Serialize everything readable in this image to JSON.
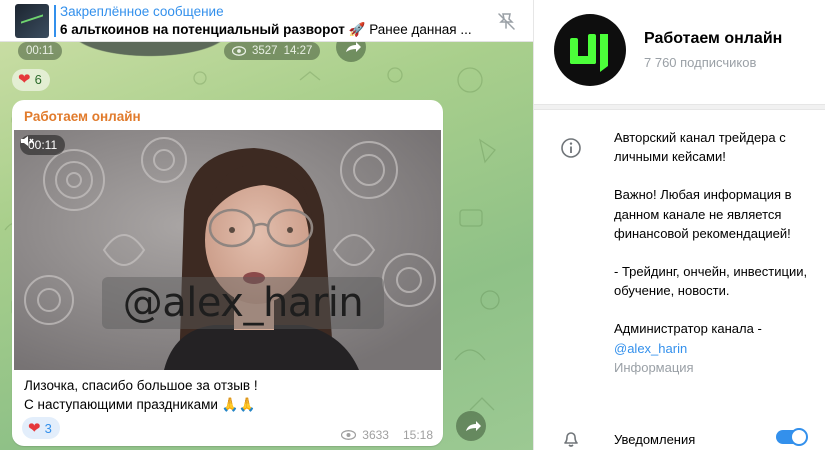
{
  "pinned": {
    "title": "Закреплённое сообщение",
    "text_bold": "6 альткоинов на потенциальный разворот 🚀",
    "text_rest": "Ранее данная ..."
  },
  "previous_message": {
    "duration": "00:11",
    "views": "3527",
    "time": "14:27",
    "reaction_count": "6"
  },
  "message": {
    "author": "Работаем онлайн",
    "video_duration": "00:11",
    "video_watermark": "@alex_harin",
    "caption_line1": "Лизочка, спасибо большое за отзыв !",
    "caption_line2": "С наступающими праздниками 🙏🙏",
    "reaction_count": "3",
    "views": "3633",
    "time": "15:18"
  },
  "channel": {
    "name": "Работаем онлайн",
    "subscribers": "7 760 подписчиков",
    "desc_p1": "Авторский канал трейдера с личными кейсами!",
    "desc_p2": "Важно! Любая информация в данном канале не является финансовой рекомендацией!",
    "desc_p3": "- Трейдинг, ончейн, инвестиции, обучение, новости.",
    "desc_p4": "Администратор канала -",
    "admin_link": "@alex_harin",
    "info_label": "Информация",
    "notifications_label": "Уведомления",
    "notifications_on": true
  },
  "colors": {
    "accent": "#3390ec",
    "author": "#e17b2c",
    "heart": "#e5383b",
    "logo_green": "#4cff3a"
  },
  "icons": [
    "pin-off-icon",
    "eye-icon",
    "share-icon",
    "heart-icon",
    "mute-icon",
    "info-icon",
    "bell-icon"
  ]
}
